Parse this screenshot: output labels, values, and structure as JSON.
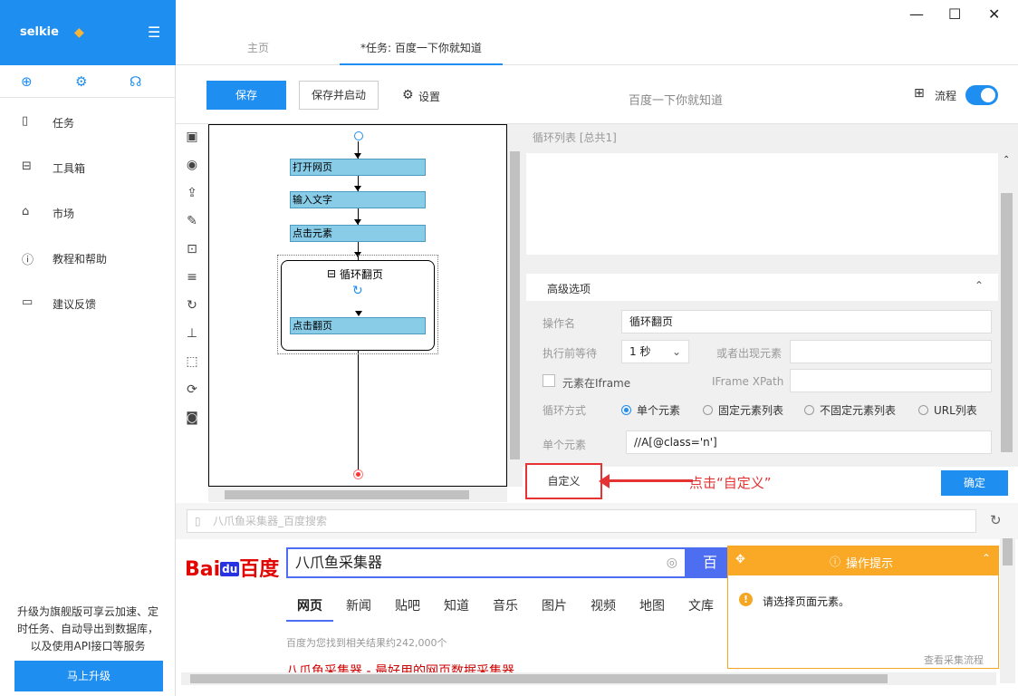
{
  "sidebar": {
    "brand": "selkie",
    "nav": [
      {
        "label": "任务",
        "icon": "file-icon"
      },
      {
        "label": "工具箱",
        "icon": "toolbox-icon"
      },
      {
        "label": "市场",
        "icon": "bag-icon"
      },
      {
        "label": "教程和帮助",
        "icon": "help-icon"
      },
      {
        "label": "建议反馈",
        "icon": "feedback-icon"
      }
    ],
    "promo": "升级为旗舰版可享云加速、定时任务、自动导出到数据库，以及使用API接口等服务",
    "upgrade_button": "马上升级"
  },
  "tabs": [
    {
      "label": "主页"
    },
    {
      "label": "*任务: 百度一下你就知道"
    }
  ],
  "toolbar": {
    "save": "保存",
    "save_start": "保存并启动",
    "settings": "设置",
    "task_title": "百度一下你就知道",
    "flow_label": "流程"
  },
  "flow": {
    "nodes": [
      "打开网页",
      "输入文字",
      "点击元素"
    ],
    "loop_label": "循环翻页",
    "loop_inner": "点击翻页"
  },
  "right": {
    "loop_list_title": "循环列表 [总共1]",
    "advanced_title": "高级选项",
    "op_name_label": "操作名",
    "op_name_value": "循环翻页",
    "wait_label": "执行前等待",
    "wait_value": "1 秒",
    "or_appear_label": "或者出现元素",
    "iframe_checkbox": "元素在Iframe",
    "iframe_xpath_label": "IFrame XPath",
    "loop_mode_label": "循环方式",
    "loop_modes": [
      "单个元素",
      "固定元素列表",
      "不固定元素列表",
      "URL列表"
    ],
    "single_label": "单个元素",
    "single_value": "//A[@class='n']",
    "custom_button": "自定义",
    "annotation": "点击“自定义”",
    "confirm_button": "确定"
  },
  "browser": {
    "url": "八爪鱼采集器_百度搜索",
    "logo_left": "Bai",
    "logo_du": "du",
    "logo_right": "百度",
    "search_value": "八爪鱼采集器",
    "search_button": "百度",
    "search_tabs": [
      "网页",
      "新闻",
      "贴吧",
      "知道",
      "音乐",
      "图片",
      "视频",
      "地图",
      "文库"
    ],
    "result_count": "百度为您找到相关结果约242,000个",
    "first_result": "八爪鱼采集器 - 最好用的网页数据采集器"
  },
  "tip": {
    "title": "操作提示",
    "message": "请选择页面元素。",
    "link": "查看采集流程"
  }
}
